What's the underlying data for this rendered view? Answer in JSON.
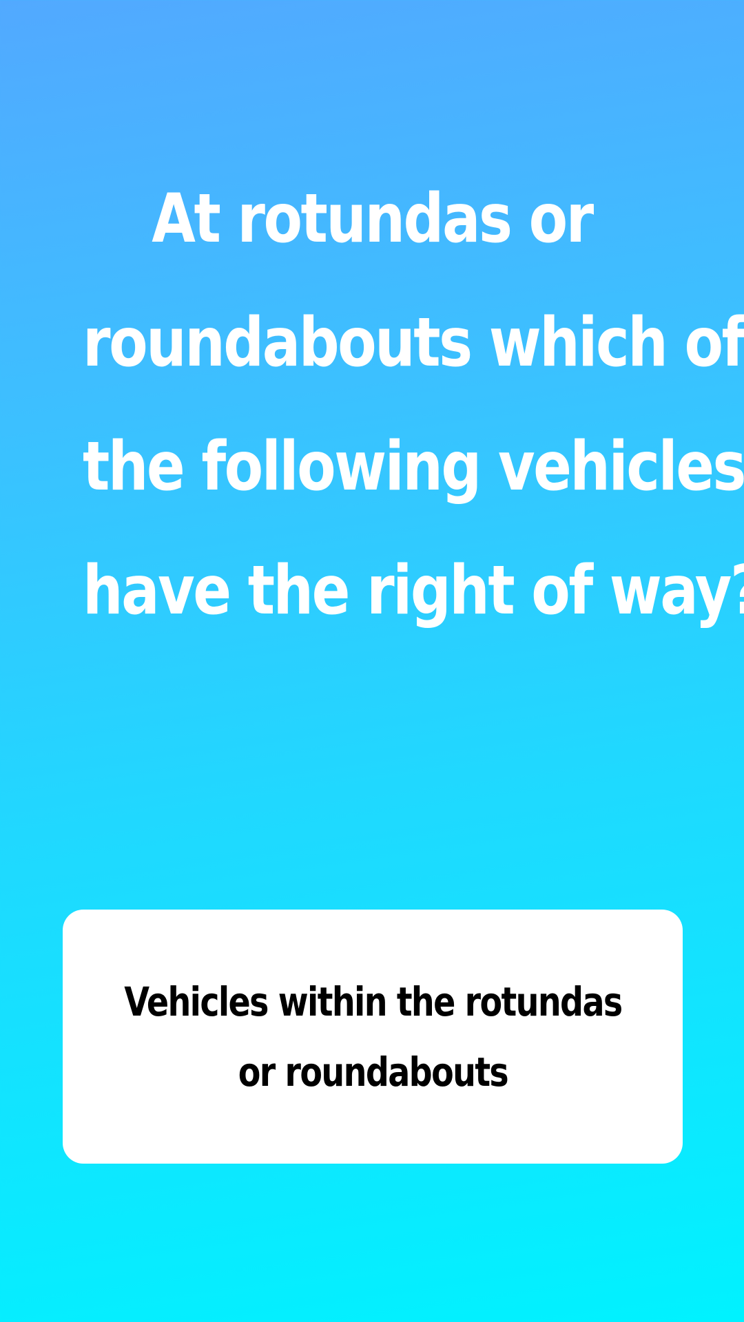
{
  "question": {
    "lines": [
      "At rotundas or",
      "roundabouts which of",
      "the following vehicles",
      "have the right of way?"
    ]
  },
  "answer": {
    "lines": [
      "Vehicles within the rotundas",
      "or roundabouts"
    ]
  },
  "colors": {
    "background_top": "#52a9ff",
    "background_bottom": "#00f2ff",
    "question_text": "#ffffff",
    "card_background": "#ffffff",
    "answer_text": "#000000"
  }
}
